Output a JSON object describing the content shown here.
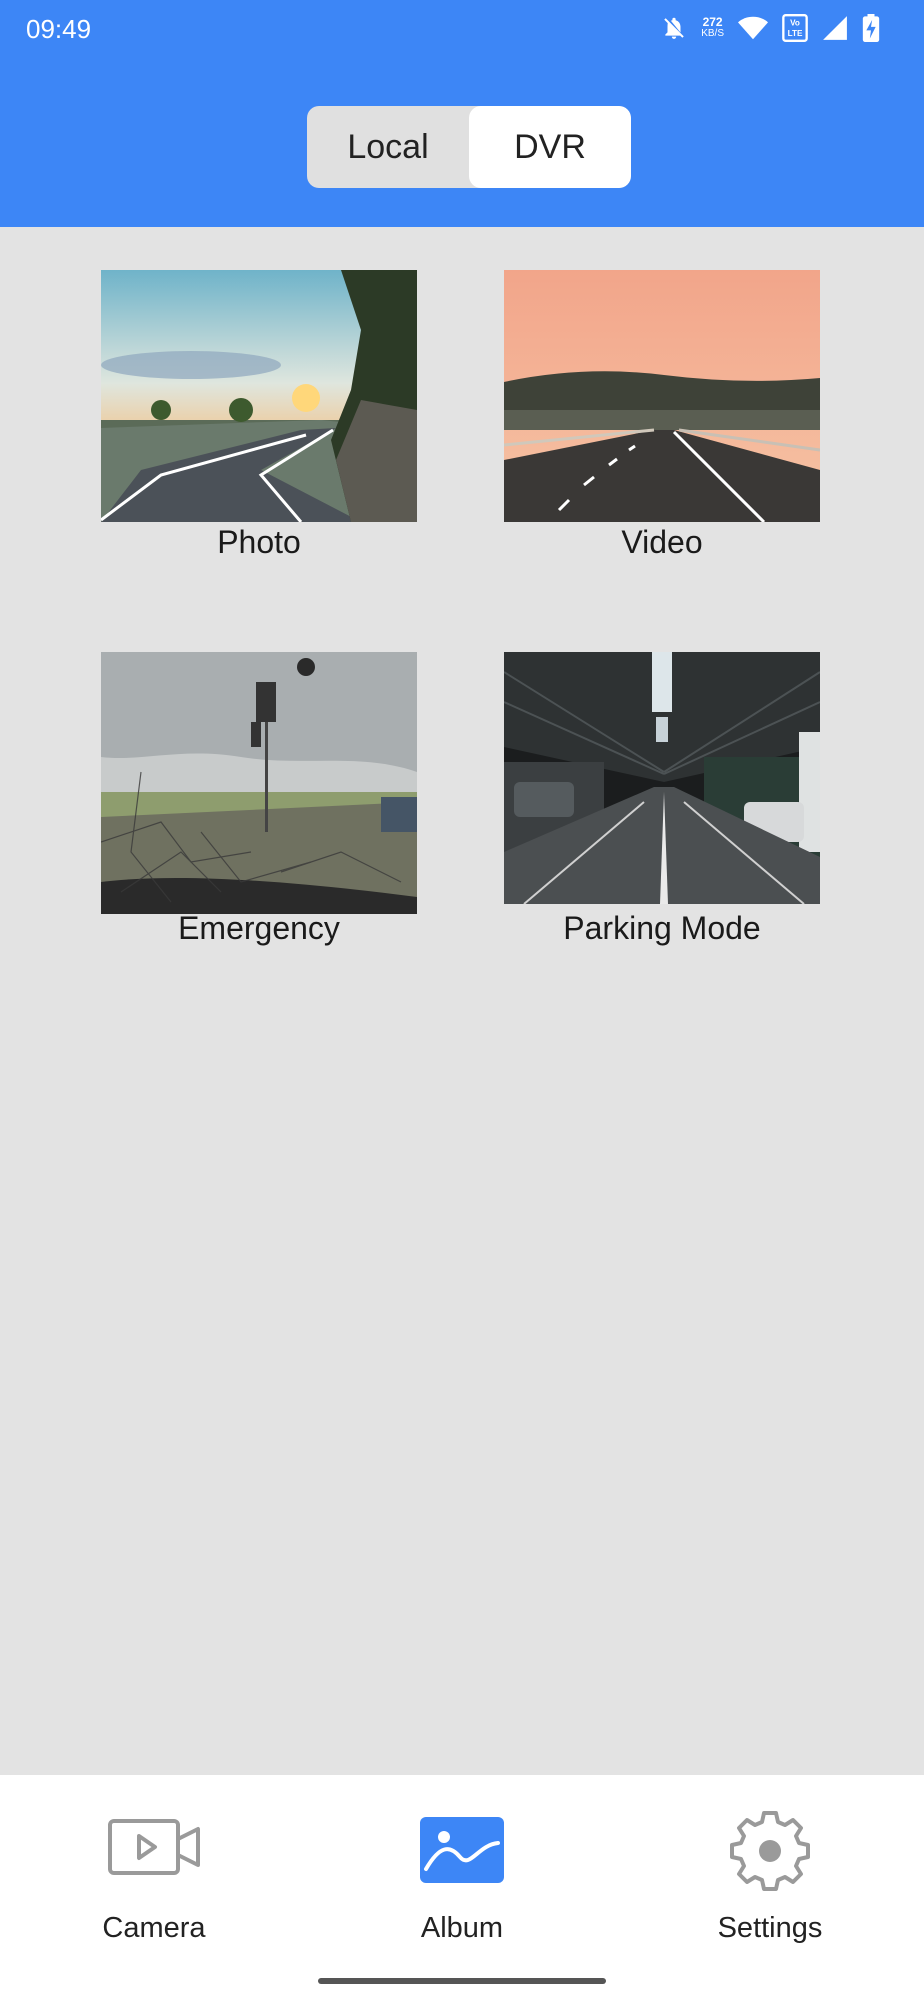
{
  "status_bar": {
    "time": "09:49",
    "speed_value": "272",
    "speed_unit": "KB/S",
    "icons": [
      "bell-off-icon",
      "wifi-icon",
      "volte-icon",
      "signal-icon",
      "battery-charging-icon"
    ]
  },
  "segment": {
    "options": [
      "Local",
      "DVR"
    ],
    "selected": "DVR"
  },
  "album": {
    "tiles": [
      {
        "label": "Photo",
        "image": "mountain-road-sunset-image"
      },
      {
        "label": "Video",
        "image": "highway-dusk-image"
      },
      {
        "label": "Emergency",
        "image": "cracked-windshield-image"
      },
      {
        "label": "Parking Mode",
        "image": "parking-garage-image"
      }
    ]
  },
  "bottom_nav": {
    "items": [
      {
        "label": "Camera",
        "icon": "video-camera-icon"
      },
      {
        "label": "Album",
        "icon": "album-image-icon",
        "active": true
      },
      {
        "label": "Settings",
        "icon": "gear-icon"
      }
    ]
  },
  "colors": {
    "accent": "#3d86f6",
    "background": "#e3e3e3",
    "icon_inactive": "#9a9a9a"
  }
}
